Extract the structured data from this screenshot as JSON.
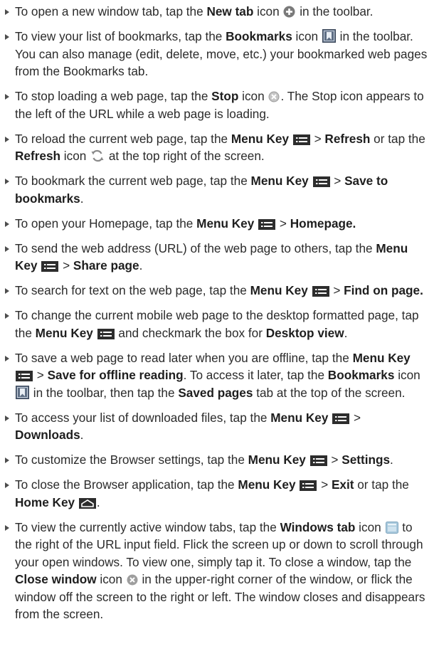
{
  "items": [
    {
      "name": "new-tab",
      "segs": [
        {
          "t": "text",
          "v": "To open a new window tab, tap the "
        },
        {
          "t": "bold",
          "v": "New tab"
        },
        {
          "t": "text",
          "v": " icon "
        },
        {
          "t": "icon",
          "v": "plus-circle-icon"
        },
        {
          "t": "text",
          "v": " in the toolbar."
        }
      ]
    },
    {
      "name": "bookmarks",
      "segs": [
        {
          "t": "text",
          "v": "To view your list of bookmarks, tap the "
        },
        {
          "t": "bold",
          "v": "Bookmarks"
        },
        {
          "t": "text",
          "v": " icon "
        },
        {
          "t": "icon",
          "v": "bookmark-icon"
        },
        {
          "t": "text",
          "v": " in the toolbar. You can also manage (edit, delete, move, etc.) your bookmarked web pages from the Bookmarks tab."
        }
      ]
    },
    {
      "name": "stop",
      "segs": [
        {
          "t": "text",
          "v": "To stop loading a web page, tap the "
        },
        {
          "t": "bold",
          "v": "Stop"
        },
        {
          "t": "text",
          "v": " icon "
        },
        {
          "t": "icon",
          "v": "stop-icon"
        },
        {
          "t": "text",
          "v": ". The Stop icon appears to the left of the URL while a web page is loading."
        }
      ]
    },
    {
      "name": "reload",
      "segs": [
        {
          "t": "text",
          "v": "To reload the current web page, tap the "
        },
        {
          "t": "bold",
          "v": "Menu Key"
        },
        {
          "t": "text",
          "v": " "
        },
        {
          "t": "icon",
          "v": "menu-key-icon"
        },
        {
          "t": "text",
          "v": " > "
        },
        {
          "t": "bold",
          "v": "Refresh"
        },
        {
          "t": "text",
          "v": " or tap the "
        },
        {
          "t": "bold",
          "v": "Refresh"
        },
        {
          "t": "text",
          "v": " icon "
        },
        {
          "t": "icon",
          "v": "refresh-icon"
        },
        {
          "t": "text",
          "v": " at the top right of the screen."
        }
      ]
    },
    {
      "name": "save-bookmark",
      "segs": [
        {
          "t": "text",
          "v": "To bookmark the current web page, tap the "
        },
        {
          "t": "bold",
          "v": "Menu Key"
        },
        {
          "t": "text",
          "v": " "
        },
        {
          "t": "icon",
          "v": "menu-key-icon"
        },
        {
          "t": "text",
          "v": " > "
        },
        {
          "t": "bold",
          "v": "Save to bookmarks"
        },
        {
          "t": "text",
          "v": "."
        }
      ]
    },
    {
      "name": "homepage",
      "segs": [
        {
          "t": "text",
          "v": "To open your Homepage, tap the "
        },
        {
          "t": "bold",
          "v": "Menu Key"
        },
        {
          "t": "text",
          "v": " "
        },
        {
          "t": "icon",
          "v": "menu-key-icon"
        },
        {
          "t": "text",
          "v": " > "
        },
        {
          "t": "bold",
          "v": "Homepage."
        }
      ]
    },
    {
      "name": "share-page",
      "segs": [
        {
          "t": "text",
          "v": "To send the web address (URL) of the web page to others, tap the "
        },
        {
          "t": "bold",
          "v": "Menu Key"
        },
        {
          "t": "text",
          "v": " "
        },
        {
          "t": "icon",
          "v": "menu-key-icon"
        },
        {
          "t": "text",
          "v": " > "
        },
        {
          "t": "bold",
          "v": "Share page"
        },
        {
          "t": "text",
          "v": "."
        }
      ]
    },
    {
      "name": "find-on-page",
      "segs": [
        {
          "t": "text",
          "v": "To search for text on the web page, tap the "
        },
        {
          "t": "bold",
          "v": "Menu Key"
        },
        {
          "t": "text",
          "v": " "
        },
        {
          "t": "icon",
          "v": "menu-key-icon"
        },
        {
          "t": "text",
          "v": " > "
        },
        {
          "t": "bold",
          "v": "Find on page."
        }
      ]
    },
    {
      "name": "desktop-view",
      "segs": [
        {
          "t": "text",
          "v": "To change the current mobile web page to the desktop formatted page, tap the "
        },
        {
          "t": "bold",
          "v": "Menu Key"
        },
        {
          "t": "text",
          "v": " "
        },
        {
          "t": "icon",
          "v": "menu-key-icon"
        },
        {
          "t": "text",
          "v": " and checkmark the box for "
        },
        {
          "t": "bold",
          "v": "Desktop view"
        },
        {
          "t": "text",
          "v": "."
        }
      ]
    },
    {
      "name": "offline-reading",
      "segs": [
        {
          "t": "text",
          "v": "To save a web page to read later when you are offline, tap the "
        },
        {
          "t": "bold",
          "v": "Menu Key"
        },
        {
          "t": "text",
          "v": " "
        },
        {
          "t": "icon",
          "v": "menu-key-icon"
        },
        {
          "t": "text",
          "v": " > "
        },
        {
          "t": "bold",
          "v": "Save for offline reading"
        },
        {
          "t": "text",
          "v": ". To access it later, tap the "
        },
        {
          "t": "bold",
          "v": "Bookmarks"
        },
        {
          "t": "text",
          "v": " icon "
        },
        {
          "t": "icon",
          "v": "bookmark-icon"
        },
        {
          "t": "text",
          "v": " in the toolbar, then tap the "
        },
        {
          "t": "bold",
          "v": "Saved pages"
        },
        {
          "t": "text",
          "v": " tab at the top of the screen."
        }
      ]
    },
    {
      "name": "downloads",
      "segs": [
        {
          "t": "text",
          "v": "To access your list of downloaded files, tap the "
        },
        {
          "t": "bold",
          "v": "Menu Key"
        },
        {
          "t": "text",
          "v": " "
        },
        {
          "t": "icon",
          "v": "menu-key-icon"
        },
        {
          "t": "text",
          "v": " > "
        },
        {
          "t": "bold",
          "v": "Downloads"
        },
        {
          "t": "text",
          "v": "."
        }
      ]
    },
    {
      "name": "settings",
      "segs": [
        {
          "t": "text",
          "v": "To customize the Browser settings, tap the "
        },
        {
          "t": "bold",
          "v": "Menu Key"
        },
        {
          "t": "text",
          "v": " "
        },
        {
          "t": "icon",
          "v": "menu-key-icon"
        },
        {
          "t": "text",
          "v": " > "
        },
        {
          "t": "bold",
          "v": "Settings"
        },
        {
          "t": "text",
          "v": "."
        }
      ]
    },
    {
      "name": "exit",
      "segs": [
        {
          "t": "text",
          "v": "To close the Browser application, tap the "
        },
        {
          "t": "bold",
          "v": "Menu Key"
        },
        {
          "t": "text",
          "v": " "
        },
        {
          "t": "icon",
          "v": "menu-key-icon"
        },
        {
          "t": "text",
          "v": " > "
        },
        {
          "t": "bold",
          "v": "Exit"
        },
        {
          "t": "text",
          "v": " or tap the "
        },
        {
          "t": "bold",
          "v": "Home Key"
        },
        {
          "t": "text",
          "v": " "
        },
        {
          "t": "icon",
          "v": "home-key-icon"
        },
        {
          "t": "text",
          "v": "."
        }
      ]
    },
    {
      "name": "windows-tab",
      "segs": [
        {
          "t": "text",
          "v": "To view the currently active window tabs, tap the "
        },
        {
          "t": "bold",
          "v": "Windows tab"
        },
        {
          "t": "text",
          "v": " icon "
        },
        {
          "t": "icon",
          "v": "windows-tab-icon"
        },
        {
          "t": "text",
          "v": " to the right of the URL input field. Flick the screen up or down to scroll through your open windows. To view one, simply tap it. To close a window, tap the "
        },
        {
          "t": "bold",
          "v": "Close window"
        },
        {
          "t": "text",
          "v": " icon "
        },
        {
          "t": "icon",
          "v": "close-window-icon"
        },
        {
          "t": "text",
          "v": " in the upper-right corner of the window, or flick the window off the screen to the right or left. The window closes and disappears from the screen."
        }
      ]
    }
  ]
}
